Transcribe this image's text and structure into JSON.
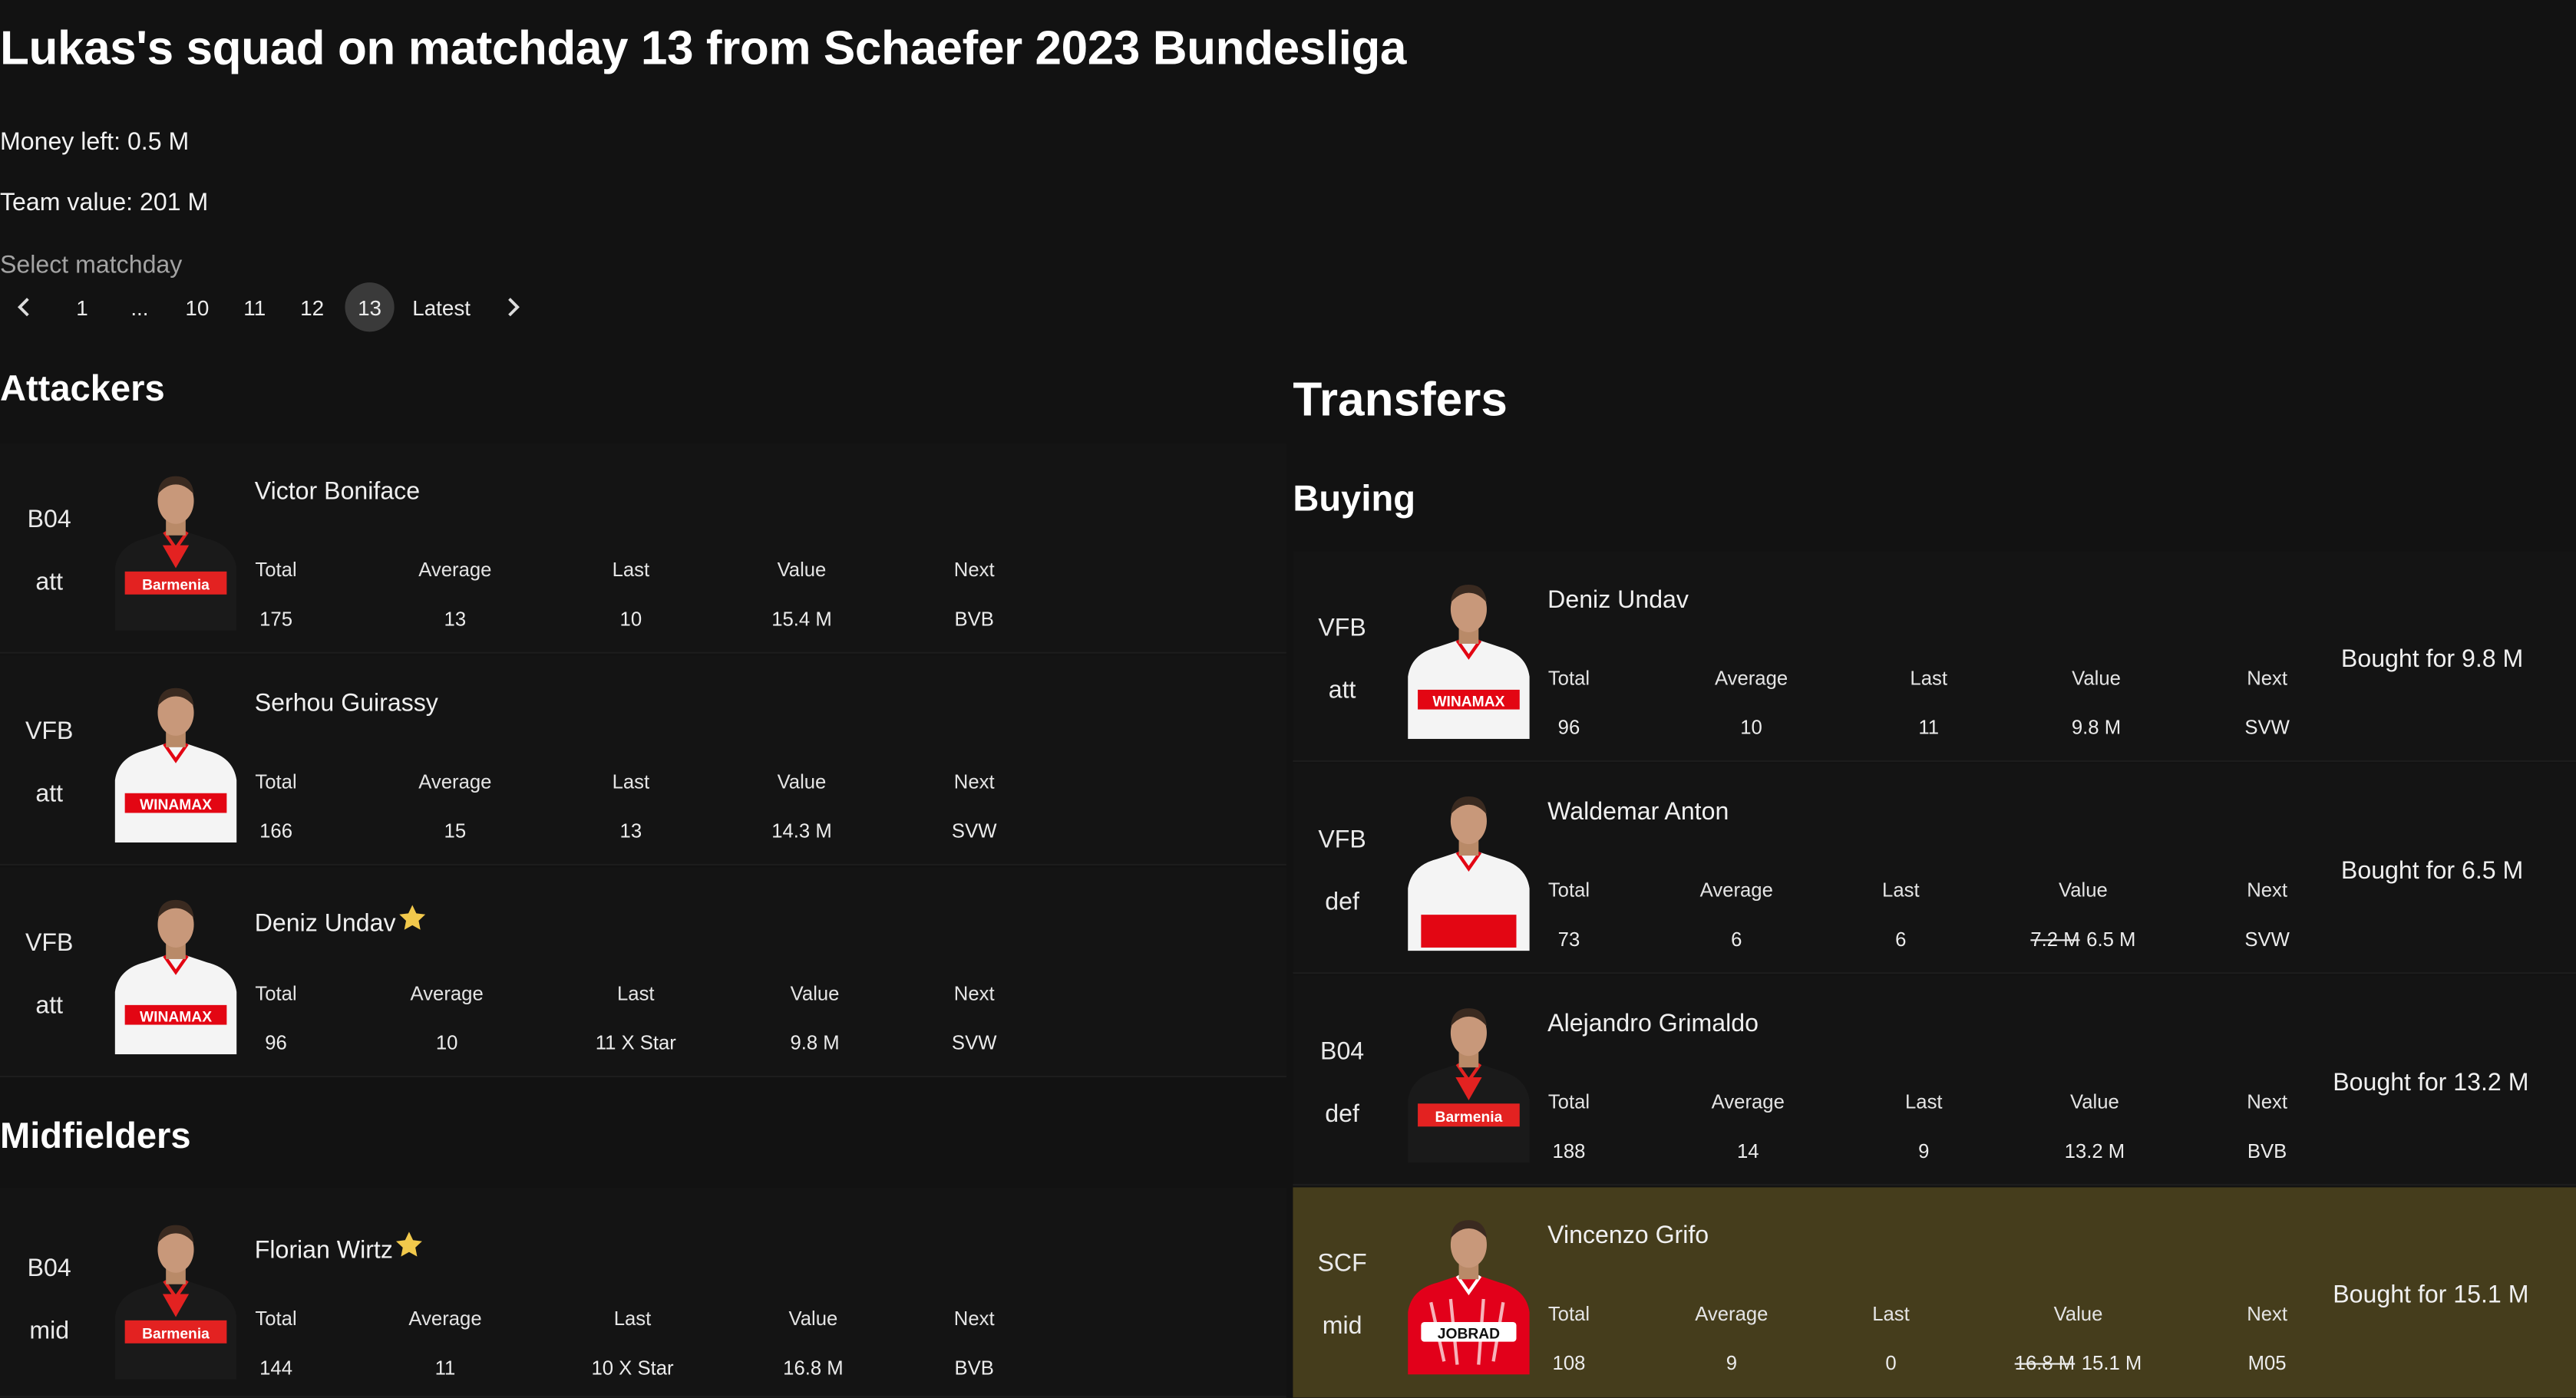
{
  "page_title": "Lukas's squad on matchday 13 from Schaefer 2023 Bundesliga",
  "money_left": "Money left: 0.5 M",
  "team_value": "Team value: 201 M",
  "select_matchday_label": "Select matchday",
  "pagination": {
    "prev_icon": "chevron-left-icon",
    "next_icon": "chevron-right-icon",
    "items": [
      "1",
      "...",
      "10",
      "11",
      "12",
      "13",
      "Latest"
    ],
    "selected": "13"
  },
  "colors": {
    "background": "#121212",
    "highlight_row": "#453d1c",
    "star": "#f2c94c",
    "leverkusen_red": "#e32221",
    "stuttgart_red": "#e30613",
    "freiburg_red": "#e2001a"
  },
  "columns": [
    "Total",
    "Average",
    "Last",
    "Value",
    "Next"
  ],
  "attackers": {
    "heading": "Attackers",
    "players": [
      {
        "club": "B04",
        "position": "att",
        "name": "Victor Boniface",
        "star": false,
        "total": "175",
        "average": "13",
        "last": "10",
        "value_old": "",
        "value": "15.4 M",
        "next": "BVB",
        "kit_sponsor": "Barmenia",
        "kit": "leverkusen"
      },
      {
        "club": "VFB",
        "position": "att",
        "name": "Serhou Guirassy",
        "star": false,
        "total": "166",
        "average": "15",
        "last": "13",
        "value_old": "",
        "value": "14.3 M",
        "next": "SVW",
        "kit_sponsor": "WINAMAX",
        "kit": "stuttgart"
      },
      {
        "club": "VFB",
        "position": "att",
        "name": "Deniz Undav",
        "star": true,
        "total": "96",
        "average": "10",
        "last": "11 X Star",
        "value_old": "",
        "value": "9.8 M",
        "next": "SVW",
        "kit_sponsor": "WINAMAX",
        "kit": "stuttgart"
      }
    ]
  },
  "midfielders": {
    "heading": "Midfielders",
    "players": [
      {
        "club": "B04",
        "position": "mid",
        "name": "Florian Wirtz",
        "star": true,
        "total": "144",
        "average": "11",
        "last": "10 X Star",
        "value_old": "",
        "value": "16.8 M",
        "next": "BVB",
        "kit_sponsor": "Barmenia",
        "kit": "leverkusen"
      }
    ]
  },
  "transfers": {
    "heading": "Transfers",
    "buying_heading": "Buying",
    "players": [
      {
        "club": "VFB",
        "position": "att",
        "name": "Deniz Undav",
        "total": "96",
        "average": "10",
        "last": "11",
        "value_old": "",
        "value": "9.8 M",
        "next": "SVW",
        "bought": "Bought for 9.8 M",
        "kit_sponsor": "WINAMAX",
        "kit": "stuttgart",
        "highlighted": false
      },
      {
        "club": "VFB",
        "position": "def",
        "name": "Waldemar Anton",
        "total": "73",
        "average": "6",
        "last": "6",
        "value_old": "7.2 M",
        "value": "6.5 M",
        "next": "SVW",
        "bought": "Bought for 6.5 M",
        "kit_sponsor": "",
        "kit": "stuttgart-plain",
        "highlighted": false
      },
      {
        "club": "B04",
        "position": "def",
        "name": "Alejandro Grimaldo",
        "total": "188",
        "average": "14",
        "last": "9",
        "value_old": "",
        "value": "13.2 M",
        "next": "BVB",
        "bought": "Bought for 13.2 M",
        "kit_sponsor": "Barmenia",
        "kit": "leverkusen",
        "highlighted": false
      },
      {
        "club": "SCF",
        "position": "mid",
        "name": "Vincenzo Grifo",
        "total": "108",
        "average": "9",
        "last": "0",
        "value_old": "16.8 M",
        "value": "15.1 M",
        "next": "M05",
        "bought": "Bought for 15.1 M",
        "kit_sponsor": "JOBRAD",
        "kit": "freiburg",
        "highlighted": true
      }
    ]
  }
}
